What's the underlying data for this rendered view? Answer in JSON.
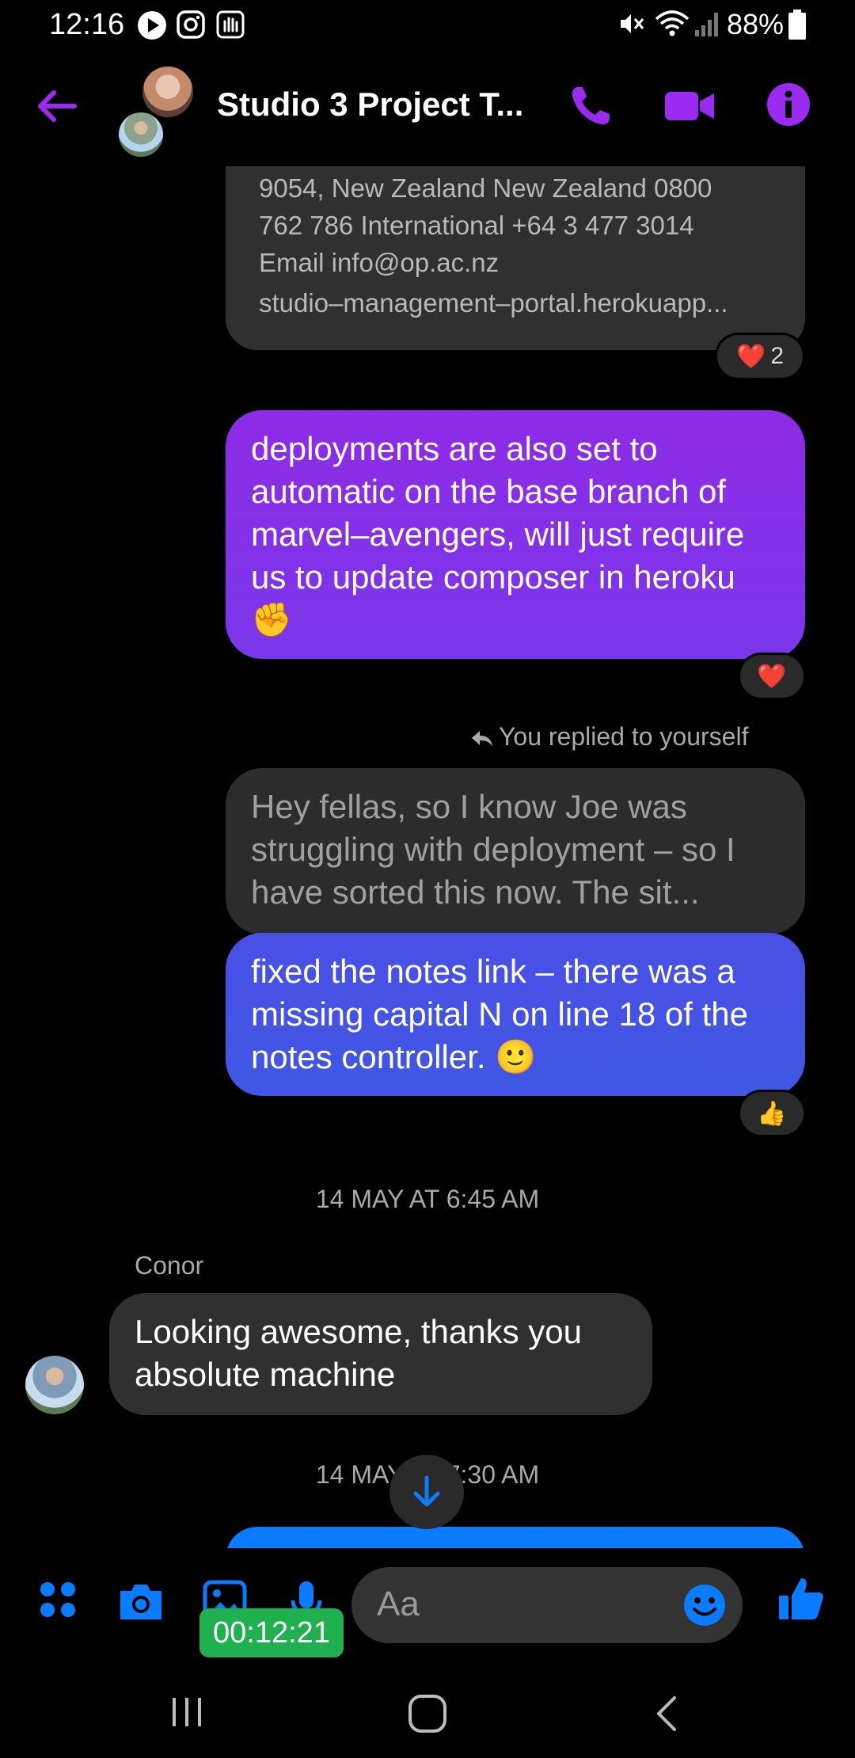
{
  "status_bar": {
    "time": "12:16",
    "battery": "88%"
  },
  "header": {
    "title": "Studio 3 Project T..."
  },
  "messages": {
    "link_preview": {
      "lines": [
        "9054, New Zealand New Zealand 0800",
        "762 786 International +64 3 477 3014",
        "Email info@op.ac.nz"
      ],
      "url": "studio–management–portal.herokuapp..."
    },
    "link_reaction": {
      "emoji": "❤️",
      "count": "2"
    },
    "deploy_msg": {
      "text": "deployments are also set to automatic on the base branch of marvel–avengers, will just require us to update composer in heroku ✊"
    },
    "deploy_reaction": {
      "emoji": "❤️"
    },
    "reply_label": "You replied to yourself",
    "quoted": {
      "text": "Hey fellas, so I know Joe was struggling with deployment – so I have sorted this now. The sit..."
    },
    "fix_msg": {
      "text": "fixed the notes link – there was a missing capital N on line 18 of the notes controller. 🙂"
    },
    "fix_reaction": {
      "emoji": "👍"
    },
    "timestamp_1": "14 MAY AT 6:45 AM",
    "sender": "Conor",
    "conor_msg": {
      "text": "Looking awesome, thanks you absolute machine"
    },
    "timestamp_2": "14 MAY AT 7:30 AM"
  },
  "composer": {
    "placeholder": "Aa",
    "timer": "00:12:21"
  },
  "colors": {
    "accent_purple": "#9b2bf0",
    "accent_blue": "#0a7cff",
    "bubble_grey": "#303030"
  },
  "icons": {
    "back": "back-arrow-icon",
    "call": "phone-icon",
    "video": "video-icon",
    "info": "info-icon",
    "menu": "grid-dots-icon",
    "camera": "camera-icon",
    "gallery": "gallery-icon",
    "mic": "mic-icon",
    "emoji": "emoji-icon",
    "like": "thumbs-up-icon"
  }
}
